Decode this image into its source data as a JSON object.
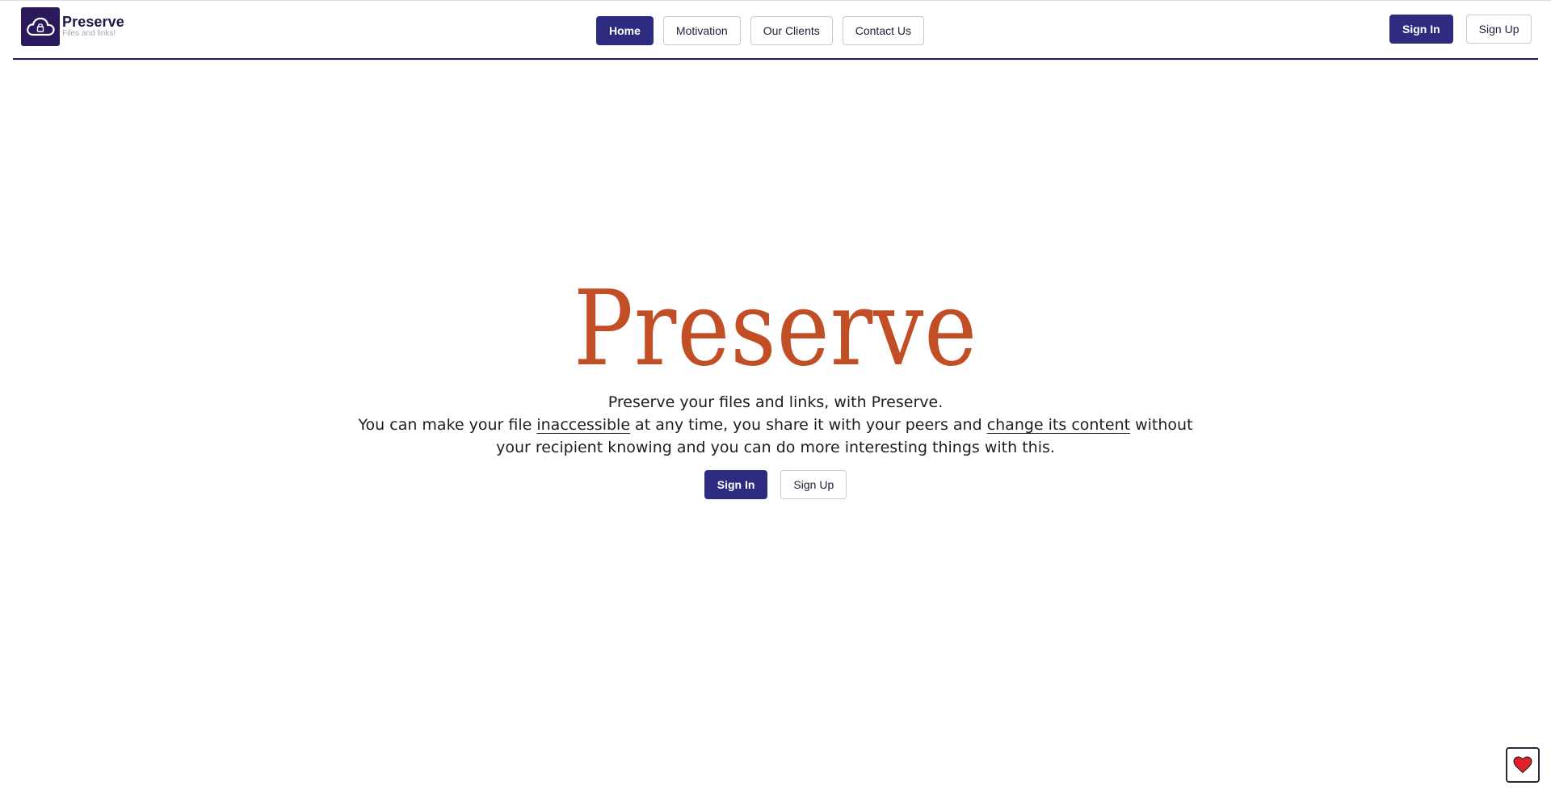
{
  "brand": {
    "name": "Preserve",
    "tagline": "Files and links!",
    "logo_icon": "cloud-icon"
  },
  "nav": {
    "items": [
      {
        "label": "Home",
        "active": true
      },
      {
        "label": "Motivation",
        "active": false
      },
      {
        "label": "Our Clients",
        "active": false
      },
      {
        "label": "Contact Us",
        "active": false
      }
    ]
  },
  "auth": {
    "sign_in": "Sign In",
    "sign_up": "Sign Up"
  },
  "hero": {
    "title": "Preserve",
    "line1": "Preserve your files and links, with Preserve.",
    "line2_part1": "You can make your file ",
    "line2_link1": "inaccessible",
    "line2_part2": " at any time, you share it with your peers and ",
    "line2_link2": "change its content",
    "line2_part3": " without",
    "line3": "your recipient knowing and you can do more interesting things with this.",
    "sign_in": "Sign In",
    "sign_up": "Sign Up"
  },
  "fab": {
    "icon": "heart-icon"
  },
  "colors": {
    "primary": "#2d2c80",
    "title": "#c14e24",
    "logo_bg": "#2a1a5c",
    "heart": "#e0202a"
  }
}
